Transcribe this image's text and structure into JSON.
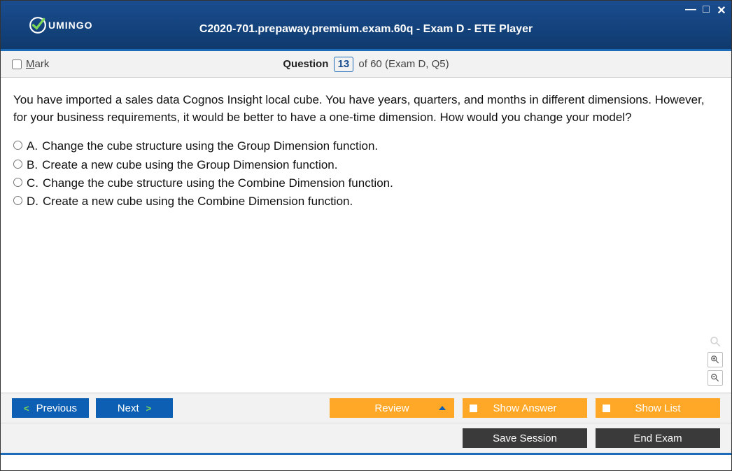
{
  "window": {
    "brand": "UMINGO",
    "title": "C2020-701.prepaway.premium.exam.60q - Exam D - ETE Player"
  },
  "questionBar": {
    "mark_label_prefix": "M",
    "mark_label_rest": "ark",
    "question_word": "Question",
    "current": "13",
    "suffix": " of 60 (Exam D, Q5)"
  },
  "prompt": "You have imported a sales data Cognos Insight local cube. You have years, quarters, and months in different dimensions. However, for your business requirements, it would be better to have a one-time dimension. How would you change your model?",
  "options": [
    {
      "letter": "A.",
      "text": "Change the cube structure using the Group Dimension function."
    },
    {
      "letter": "B.",
      "text": "Create a new cube using the Group Dimension function."
    },
    {
      "letter": "C.",
      "text": "Change the cube structure using the Combine Dimension function."
    },
    {
      "letter": "D.",
      "text": "Create a new cube using the Combine Dimension function."
    }
  ],
  "buttons": {
    "previous": "Previous",
    "next": "Next",
    "review": "Review",
    "show_answer": "Show Answer",
    "show_list": "Show List",
    "save_session": "Save Session",
    "end_exam": "End Exam"
  }
}
